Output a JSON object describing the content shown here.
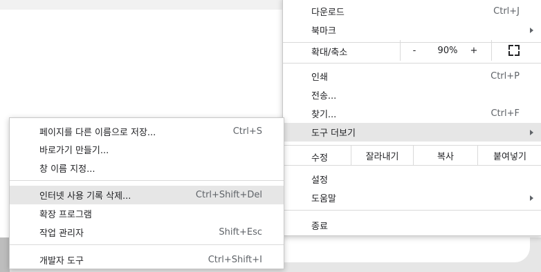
{
  "main_menu": {
    "download": {
      "label": "다운로드",
      "shortcut": "Ctrl+J"
    },
    "bookmarks": {
      "label": "북마크"
    },
    "zoom": {
      "label": "확대/축소",
      "minus": "-",
      "value": "90%",
      "plus": "+",
      "fullscreen_icon": "fullscreen-icon"
    },
    "print": {
      "label": "인쇄",
      "shortcut": "Ctrl+P"
    },
    "cast": {
      "label": "전송..."
    },
    "find": {
      "label": "찾기...",
      "shortcut": "Ctrl+F"
    },
    "more_tools": {
      "label": "도구 더보기"
    },
    "edit": {
      "label": "수정",
      "cut": "잘라내기",
      "copy": "복사",
      "paste": "붙여넣기"
    },
    "settings": {
      "label": "설정"
    },
    "help": {
      "label": "도움말"
    },
    "exit": {
      "label": "종료"
    }
  },
  "sub_menu": {
    "save_page": {
      "label": "페이지를 다른 이름으로 저장...",
      "shortcut": "Ctrl+S"
    },
    "create_shortcut": {
      "label": "바로가기 만들기..."
    },
    "name_window": {
      "label": "창 이름 지정..."
    },
    "clear_data": {
      "label": "인터넷 사용 기록 삭제...",
      "shortcut": "Ctrl+Shift+Del"
    },
    "extensions": {
      "label": "확장 프로그램"
    },
    "task_manager": {
      "label": "작업 관리자",
      "shortcut": "Shift+Esc"
    },
    "dev_tools": {
      "label": "개발자 도구",
      "shortcut": "Ctrl+Shift+I"
    }
  },
  "colors": {
    "highlight": "#e6e6e6",
    "separator": "#d9d9d9",
    "shortcut_text": "#5f6368"
  }
}
